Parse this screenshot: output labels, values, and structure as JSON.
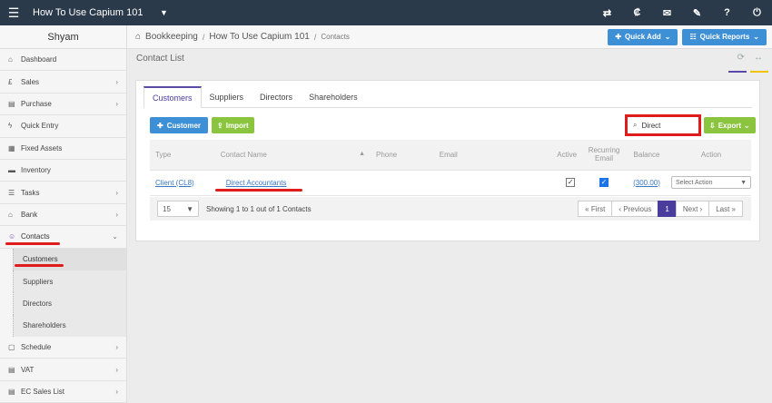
{
  "topbar": {
    "company": "How To Use Capium 101",
    "icons": [
      "transfer-icon",
      "currency-icon",
      "megaphone-icon",
      "tag-icon",
      "help-icon",
      "power-icon"
    ],
    "icon_glyphs": [
      "⇄",
      "₡",
      "✉",
      "✎",
      "?",
      "⏻"
    ]
  },
  "sidebar": {
    "user": "Shyam",
    "items": [
      {
        "label": "Dashboard",
        "icon": "⌂",
        "chevron": ""
      },
      {
        "label": "Sales",
        "icon": "£",
        "chevron": "›"
      },
      {
        "label": "Purchase",
        "icon": "▤",
        "chevron": "›"
      },
      {
        "label": "Quick Entry",
        "icon": "ϟ",
        "chevron": ""
      },
      {
        "label": "Fixed Assets",
        "icon": "▦",
        "chevron": ""
      },
      {
        "label": "Inventory",
        "icon": "▬",
        "chevron": ""
      },
      {
        "label": "Tasks",
        "icon": "☰",
        "chevron": "›"
      },
      {
        "label": "Bank",
        "icon": "⌂",
        "chevron": "›"
      },
      {
        "label": "Contacts",
        "icon": "☺",
        "chevron": "⌄"
      }
    ],
    "subitems": [
      "Customers",
      "Suppliers",
      "Directors",
      "Shareholders"
    ],
    "bottom_items": [
      {
        "label": "Schedule",
        "icon": "▢",
        "chevron": "›"
      },
      {
        "label": "VAT",
        "icon": "▤",
        "chevron": "›"
      },
      {
        "label": "EC Sales List",
        "icon": "▤",
        "chevron": "›"
      }
    ]
  },
  "breadcrumb": {
    "root": "Bookkeeping",
    "company": "How To Use Capium 101",
    "current": "Contacts"
  },
  "header_buttons": {
    "quick_add": "Quick Add",
    "quick_reports": "Quick Reports"
  },
  "page": {
    "title": "Contact List"
  },
  "tabs": [
    "Customers",
    "Suppliers",
    "Directors",
    "Shareholders"
  ],
  "actions": {
    "customer": "Customer",
    "import": "Import",
    "export": "Export"
  },
  "search": {
    "value": "Direct"
  },
  "table": {
    "columns": [
      "Type",
      "Contact Name",
      "Phone",
      "Email",
      "Active",
      "Recurring Email",
      "Balance",
      "Action"
    ],
    "rows": [
      {
        "type": "Client (CL8)",
        "name": "Direct Accountants",
        "phone": "",
        "email": "",
        "active": true,
        "recurring": true,
        "balance": "(300.00)",
        "action": "Select Action"
      }
    ]
  },
  "footer": {
    "page_size": "15",
    "showing": "Showing 1 to 1 out of 1 Contacts",
    "pager": [
      "« First",
      "‹ Previous",
      "1",
      "Next ›",
      "Last »"
    ]
  },
  "colors": {
    "topbar": "#2b3a4a",
    "accent_purple": "#4a3c9c",
    "blue_button": "#3d8fd6",
    "green_button": "#8bc53f",
    "highlight_red": "#e01b1b"
  }
}
